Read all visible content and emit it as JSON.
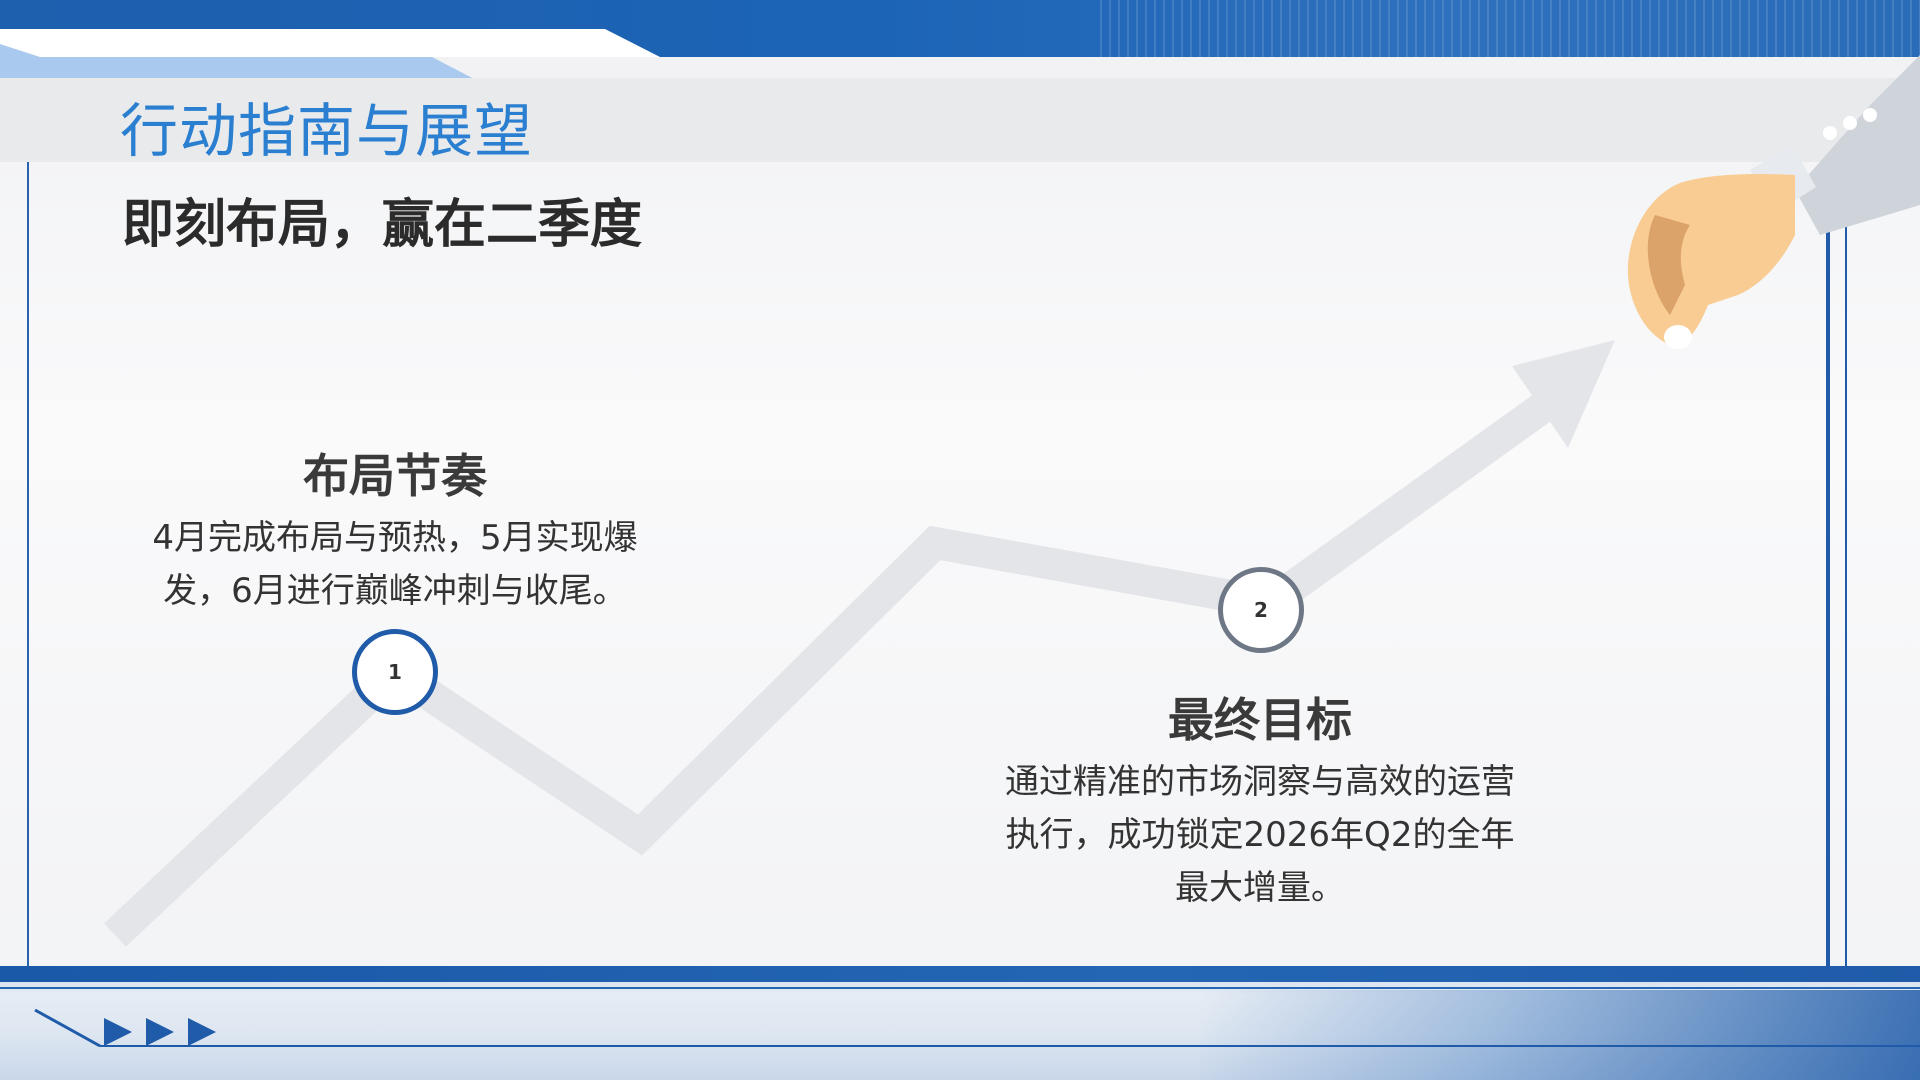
{
  "header": {
    "title": "行动指南与展望"
  },
  "main": {
    "heading": "即刻布局，赢在二季度",
    "steps": [
      {
        "marker": "1",
        "title": "布局节奏",
        "description": "4月完成布局与预热，5月实现爆发，6月进行巅峰冲刺与收尾。"
      },
      {
        "marker": "2",
        "title": "最终目标",
        "description": "通过精准的市场洞察与高效的运营执行，成功锁定2026年Q2的全年最大增量。"
      }
    ]
  },
  "colors": {
    "brand_blue": "#1f5ba8",
    "title_blue": "#2b7fd0",
    "arrow_grey": "#e3e5e9",
    "marker2_border": "#6d7785",
    "hand_skin": "#f8cc92",
    "sleeve": "#cfd4da"
  },
  "icons": {
    "growth_arrow": "trend-arrow-icon",
    "hand": "pointing-hand-icon",
    "play_triangles": "play-triangle-icon"
  }
}
